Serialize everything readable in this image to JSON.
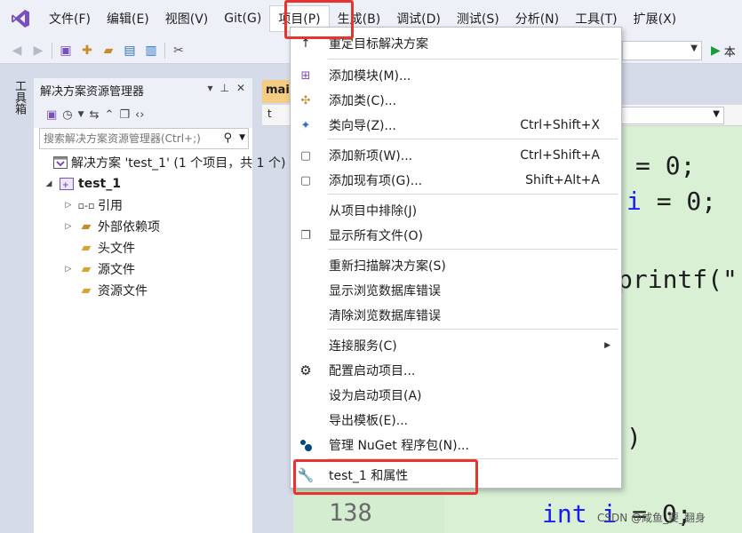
{
  "menubar": {
    "items": [
      {
        "label": "文件(F)"
      },
      {
        "label": "编辑(E)"
      },
      {
        "label": "视图(V)"
      },
      {
        "label": "Git(G)"
      },
      {
        "label": "项目(P)"
      },
      {
        "label": "生成(B)"
      },
      {
        "label": "调试(D)"
      },
      {
        "label": "测试(S)"
      },
      {
        "label": "分析(N)"
      },
      {
        "label": "工具(T)"
      },
      {
        "label": "扩展(X)"
      }
    ]
  },
  "toolbar": {
    "run_label": "本"
  },
  "toolbox": {
    "label": "工具箱"
  },
  "solution_explorer": {
    "title": "解决方案资源管理器",
    "search_placeholder": "搜索解决方案资源管理器(Ctrl+;)",
    "tree": {
      "solution": "解决方案 'test_1' (1 个项目，共 1 个)",
      "project": "test_1",
      "references": "引用",
      "external_deps": "外部依赖项",
      "headers": "头文件",
      "sources": "源文件",
      "resources": "资源文件"
    }
  },
  "editor": {
    "tab_label": "mai",
    "nav_label": "t",
    "line_number": "138",
    "code": {
      "line1": "= 0;",
      "line2_var": "i",
      "line2_rest": " = 0;",
      "line3": "printf(\"",
      "line4": ")",
      "line5_kw": "int",
      "line5_var": " i",
      "line5_rest": " = 0;"
    }
  },
  "project_menu": {
    "items": {
      "retarget": {
        "label": "重定目标解决方案"
      },
      "add_module": {
        "label": "添加模块(M)..."
      },
      "add_class": {
        "label": "添加类(C)..."
      },
      "class_wizard": {
        "label": "类向导(Z)...",
        "shortcut": "Ctrl+Shift+X"
      },
      "add_new_item": {
        "label": "添加新项(W)...",
        "shortcut": "Ctrl+Shift+A"
      },
      "add_existing_item": {
        "label": "添加现有项(G)...",
        "shortcut": "Shift+Alt+A"
      },
      "exclude": {
        "label": "从项目中排除(J)"
      },
      "show_all_files": {
        "label": "显示所有文件(O)"
      },
      "rescan": {
        "label": "重新扫描解决方案(S)"
      },
      "show_browse_errors": {
        "label": "显示浏览数据库错误"
      },
      "clear_browse_errors": {
        "label": "清除浏览数据库错误"
      },
      "connected_services": {
        "label": "连接服务(C)"
      },
      "config_startup": {
        "label": "配置启动项目..."
      },
      "set_startup": {
        "label": "设为启动项目(A)"
      },
      "export_template": {
        "label": "导出模板(E)..."
      },
      "manage_nuget": {
        "label": "管理 NuGet 程序包(N)..."
      },
      "properties": {
        "label": "test_1 和属性"
      }
    }
  },
  "watermark": "CSDN @咸鱼_要_翻身",
  "colors": {
    "accent_purple": "#7a4fbf",
    "highlight_red": "#e8332f",
    "editor_bg": "#d9f0d5",
    "tab_active": "#f5cc84"
  }
}
